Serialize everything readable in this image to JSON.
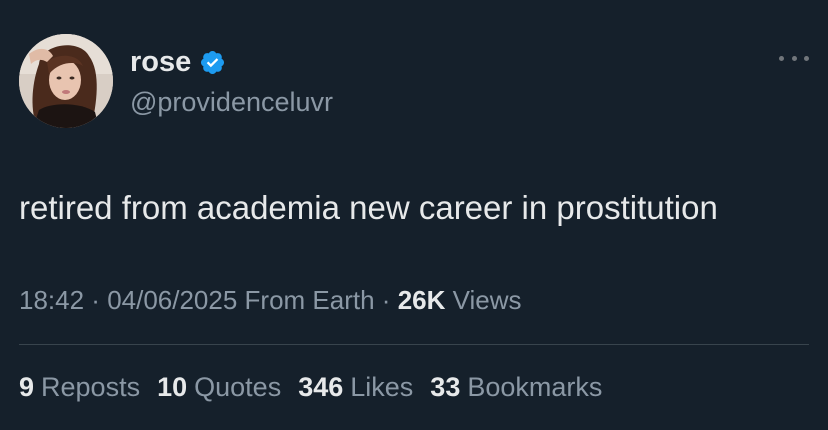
{
  "author": {
    "display_name": "rose",
    "handle": "@providenceluvr",
    "verified": true,
    "avatar_icon": "profile-photo"
  },
  "tweet": {
    "text": "retired from academia new career in prostitution"
  },
  "meta": {
    "time": "18:42",
    "separator1": " · ",
    "date": "04/06/2025",
    "location": " From Earth",
    "separator2": " · ",
    "views_count": "26K",
    "views_label": " Views"
  },
  "stats": [
    {
      "count": "9",
      "label": "Reposts"
    },
    {
      "count": "10",
      "label": "Quotes"
    },
    {
      "count": "346",
      "label": "Likes"
    },
    {
      "count": "33",
      "label": "Bookmarks"
    }
  ],
  "colors": {
    "background": "#15202b",
    "text": "#e7e9ea",
    "secondary_text": "#8b98a5",
    "verified_badge": "#1d9bf0",
    "divider": "#38444d"
  }
}
